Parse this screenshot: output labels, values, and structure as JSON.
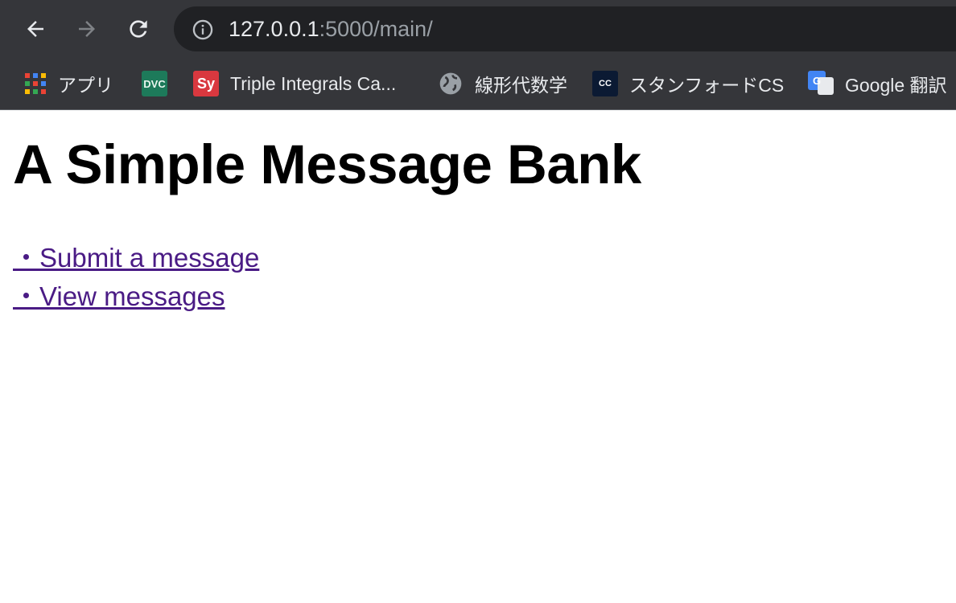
{
  "browser": {
    "url_host": "127.0.0.1",
    "url_rest": ":5000/main/",
    "back_icon": "arrow-left-icon",
    "forward_icon": "arrow-right-icon",
    "reload_icon": "reload-icon",
    "info_icon": "info-circle-icon",
    "bookmarks": [
      {
        "label": "アプリ",
        "icon": "apps-grid-icon"
      },
      {
        "label": "",
        "icon": "dvc-logo-icon",
        "favicon_text": "DVC"
      },
      {
        "label": "Triple Integrals Ca...",
        "icon": "symbolab-icon",
        "favicon_text": "Sy"
      },
      {
        "label": "線形代数学",
        "icon": "globe-icon"
      },
      {
        "label": "スタンフォードCS",
        "icon": "cc-icon",
        "favicon_text": "CC"
      },
      {
        "label": "Google 翻訳",
        "icon": "google-translate-icon",
        "favicon_text": "G"
      }
    ]
  },
  "page": {
    "title": "A Simple Message Bank",
    "links": [
      {
        "label": "・Submit a message"
      },
      {
        "label": "・View messages"
      }
    ]
  },
  "colors": {
    "chrome_bg": "#35363a",
    "omnibox_bg": "#202124",
    "link_visited": "#4a1b85"
  }
}
